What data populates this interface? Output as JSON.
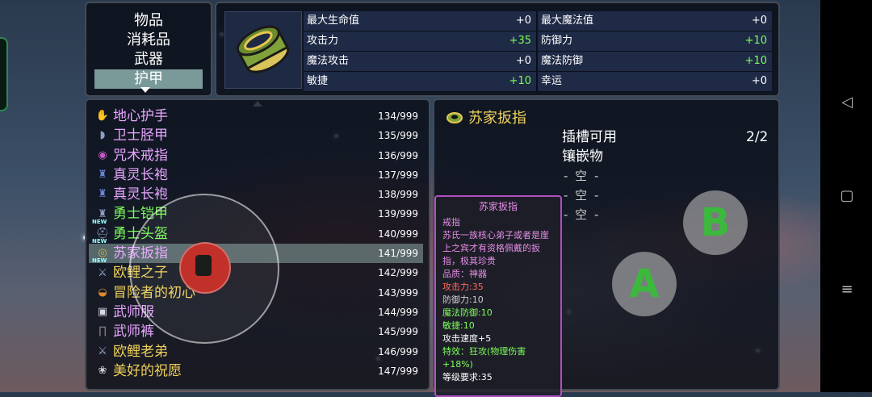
{
  "categories": [
    {
      "label": "物品",
      "selected": false
    },
    {
      "label": "消耗品",
      "selected": false
    },
    {
      "label": "武器",
      "selected": false
    },
    {
      "label": "护甲",
      "selected": true
    }
  ],
  "stats": {
    "rows": [
      [
        {
          "label": "最大生命值",
          "value": "+0",
          "color": "white"
        },
        {
          "label": "最大魔法值",
          "value": "+0",
          "color": "white"
        }
      ],
      [
        {
          "label": "攻击力",
          "value": "+35",
          "color": "green"
        },
        {
          "label": "防御力",
          "value": "+10",
          "color": "green"
        }
      ],
      [
        {
          "label": "魔法攻击",
          "value": "+0",
          "color": "white"
        },
        {
          "label": "魔法防御",
          "value": "+10",
          "color": "green"
        }
      ],
      [
        {
          "label": "敏捷",
          "value": "+10",
          "color": "green"
        },
        {
          "label": "幸运",
          "value": "+0",
          "color": "white"
        }
      ]
    ]
  },
  "items": [
    {
      "name": "地心护手",
      "count": "134/999",
      "color": "#e8a6ff",
      "icon": "gauntlet-icon",
      "new": false
    },
    {
      "name": "卫士胫甲",
      "count": "135/999",
      "color": "#e8a6ff",
      "icon": "greaves-icon",
      "new": false
    },
    {
      "name": "咒术戒指",
      "count": "136/999",
      "color": "#e8a6ff",
      "icon": "ring-icon",
      "new": false
    },
    {
      "name": "真灵长袍",
      "count": "137/999",
      "color": "#e8a6ff",
      "icon": "robe-icon",
      "new": false
    },
    {
      "name": "真灵长袍",
      "count": "138/999",
      "color": "#e8a6ff",
      "icon": "robe-icon",
      "new": false
    },
    {
      "name": "勇士铠甲",
      "count": "139/999",
      "color": "#7dff5a",
      "icon": "armor-icon",
      "new": true
    },
    {
      "name": "勇士头盔",
      "count": "140/999",
      "color": "#7dff5a",
      "icon": "helmet-icon",
      "new": true
    },
    {
      "name": "苏家扳指",
      "count": "141/999",
      "color": "#e8a6ff",
      "icon": "thumb-ring-icon",
      "new": true,
      "selected": true
    },
    {
      "name": "欧鲤之子",
      "count": "142/999",
      "color": "#f0d25a",
      "icon": "sword-icon",
      "new": false
    },
    {
      "name": "冒险者的初心",
      "count": "143/999",
      "color": "#f0d25a",
      "icon": "bowl-icon",
      "new": false
    },
    {
      "name": "武师服",
      "count": "144/999",
      "color": "#e8a6ff",
      "icon": "uniform-icon",
      "new": false
    },
    {
      "name": "武师裤",
      "count": "145/999",
      "color": "#e8a6ff",
      "icon": "pants-icon",
      "new": false
    },
    {
      "name": "欧鲤老弟",
      "count": "146/999",
      "color": "#f0d25a",
      "icon": "sword-icon",
      "new": false
    },
    {
      "name": "美好的祝愿",
      "count": "147/999",
      "color": "#f0d25a",
      "icon": "charm-icon",
      "new": false
    }
  ],
  "new_tag": "NEW",
  "detail": {
    "name": "苏家扳指",
    "slot_label": "插槽可用",
    "slot_count": "2/2",
    "inlay_label": "镶嵌物",
    "empty_slots": [
      "- 空 -",
      "- 空 -",
      "- 空 -"
    ]
  },
  "tooltip": {
    "title": "苏家扳指",
    "lines": [
      {
        "text": "戒指",
        "color": "#e58ee6"
      },
      {
        "text": "苏氏一族核心弟子或者是崖上之宾才有资格佩戴的扳指，极其珍贵",
        "color": "#e58ee6"
      },
      {
        "text": "品质：神器",
        "color": "#e58ee6"
      },
      {
        "text": "攻击力:35",
        "color": "#ff6a5a"
      },
      {
        "text": "防御力:10",
        "color": "#cfcfcf"
      },
      {
        "text": "魔法防御:10",
        "color": "#7dff5a"
      },
      {
        "text": "敏捷:10",
        "color": "#7dff5a"
      },
      {
        "text": "攻击速度+5",
        "color": "#ffffff"
      },
      {
        "text": "特效：狂攻(物理伤害+18%)",
        "color": "#7dff5a"
      },
      {
        "text": "等级要求:35",
        "color": "#ffffff"
      }
    ]
  },
  "buttons": {
    "a": "A",
    "b": "B"
  },
  "system_nav": {
    "back": "◁",
    "home": "▢",
    "menu": "≡"
  }
}
